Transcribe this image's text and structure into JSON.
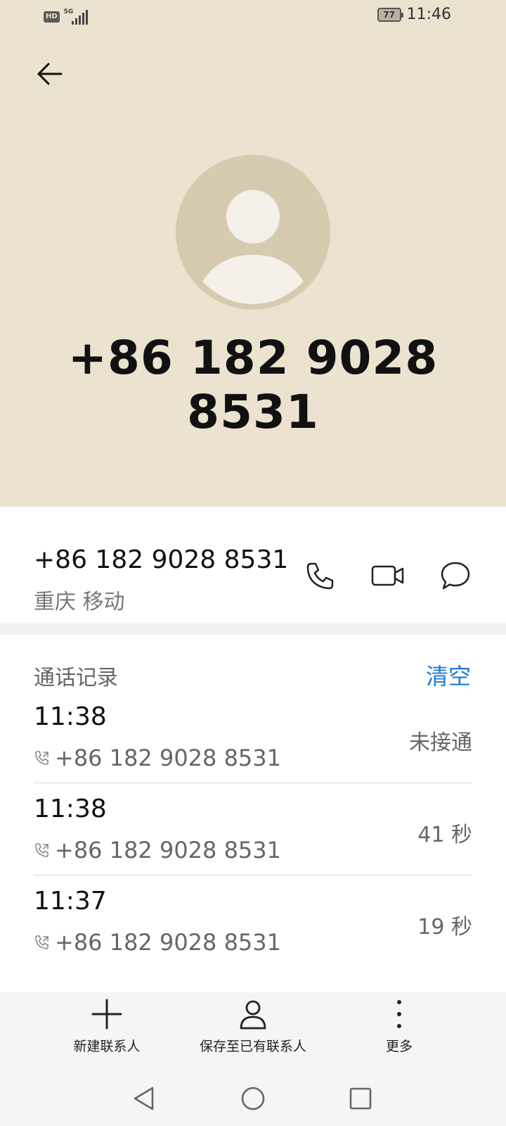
{
  "status_bar": {
    "left_badge": "HD",
    "network": "5G",
    "battery": "77",
    "time": "11:46"
  },
  "contact": {
    "header_number": "+86 182 9028 8531",
    "number": "+86 182 9028 8531",
    "location": "重庆 移动"
  },
  "call_log": {
    "title": "通话记录",
    "clear_label": "清空",
    "entries": [
      {
        "time": "11:38",
        "number": "+86 182 9028 8531",
        "status": "未接通"
      },
      {
        "time": "11:38",
        "number": "+86 182 9028 8531",
        "status": "41 秒"
      },
      {
        "time": "11:37",
        "number": "+86 182 9028 8531",
        "status": "19 秒"
      }
    ]
  },
  "bottom_actions": {
    "new_contact": "新建联系人",
    "save_existing": "保存至已有联系人",
    "more": "更多"
  },
  "icons": {
    "back": "back-arrow-icon",
    "call": "phone-icon",
    "video": "video-call-icon",
    "message": "message-icon",
    "outgoing_call": "outgoing-call-icon",
    "add": "plus-icon",
    "person": "person-icon",
    "more": "more-vertical-icon"
  },
  "colors": {
    "header_bg": "#ebe2d0",
    "avatar_bg": "#d6cbb1",
    "accent": "#1a7ad9"
  }
}
